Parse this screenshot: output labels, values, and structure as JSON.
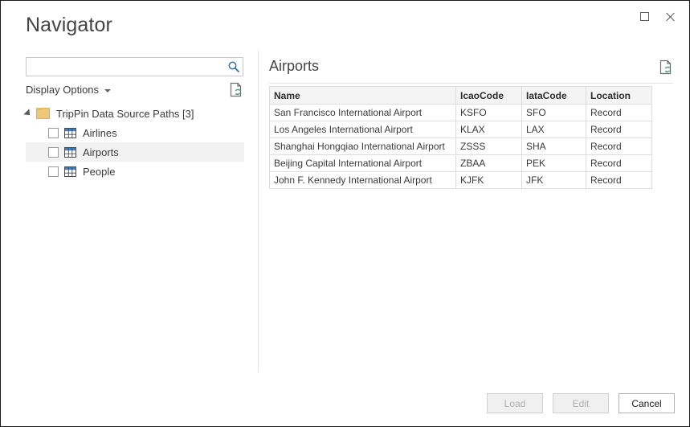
{
  "window": {
    "title": "Navigator",
    "controls": {
      "maximize": "maximize-button",
      "close": "close-button"
    }
  },
  "left_pane": {
    "search": {
      "value": "",
      "placeholder": "",
      "icon": "search-icon"
    },
    "display_options": {
      "label": "Display Options",
      "caret": "chevron-down-icon"
    },
    "refresh_icon": "refresh-document-icon",
    "tree": {
      "root": {
        "label": "TripPin Data Source Paths [3]",
        "expanded": true,
        "icon": "folder-icon"
      },
      "items": [
        {
          "label": "Airlines",
          "checked": false,
          "selected": false,
          "icon": "table-icon"
        },
        {
          "label": "Airports",
          "checked": false,
          "selected": true,
          "icon": "table-icon"
        },
        {
          "label": "People",
          "checked": false,
          "selected": false,
          "icon": "table-icon"
        }
      ]
    }
  },
  "right_pane": {
    "preview_title": "Airports",
    "refresh_icon": "refresh-document-icon",
    "table": {
      "columns": [
        "Name",
        "IcaoCode",
        "IataCode",
        "Location"
      ],
      "rows": [
        [
          "San Francisco International Airport",
          "KSFO",
          "SFO",
          "Record"
        ],
        [
          "Los Angeles International Airport",
          "KLAX",
          "LAX",
          "Record"
        ],
        [
          "Shanghai Hongqiao International Airport",
          "ZSSS",
          "SHA",
          "Record"
        ],
        [
          "Beijing Capital International Airport",
          "ZBAA",
          "PEK",
          "Record"
        ],
        [
          "John F. Kennedy International Airport",
          "KJFK",
          "JFK",
          "Record"
        ]
      ]
    }
  },
  "footer": {
    "buttons": [
      {
        "label": "Load",
        "enabled": false
      },
      {
        "label": "Edit",
        "enabled": false
      },
      {
        "label": "Cancel",
        "enabled": true
      }
    ]
  },
  "colors": {
    "accent_blue": "#2c6fa8",
    "folder": "#edc77a",
    "refresh_green": "#4f9c83",
    "selection": "#f2f2f2",
    "header_bg": "#f4f4f4",
    "border": "#dddddd"
  }
}
